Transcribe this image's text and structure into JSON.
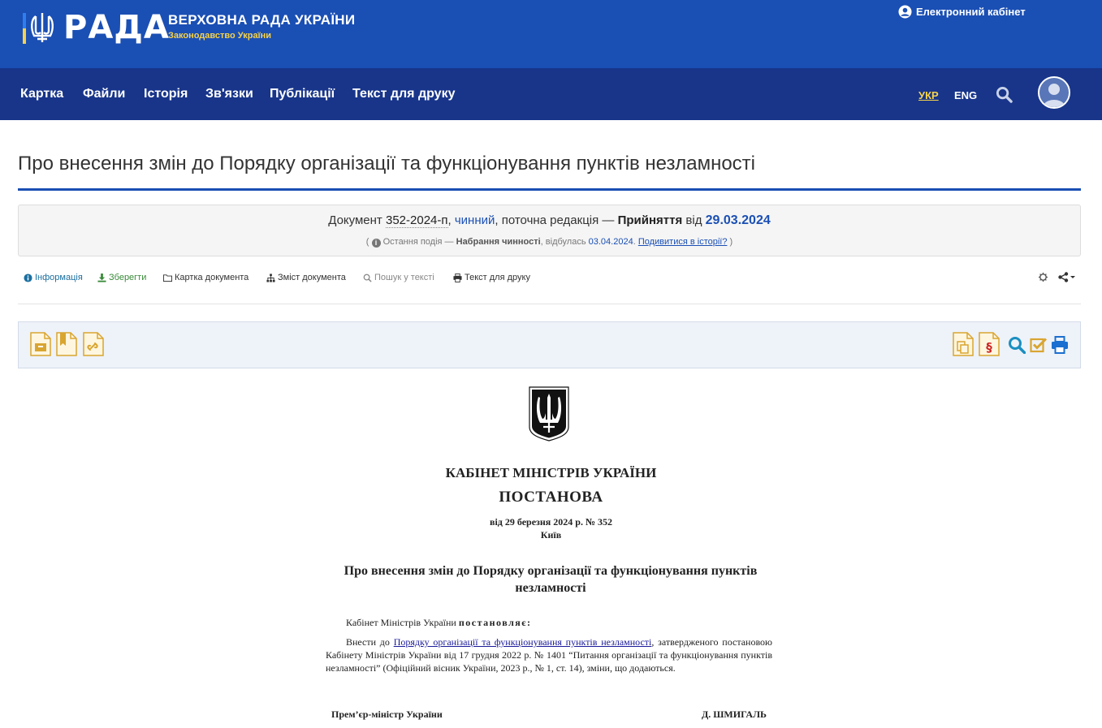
{
  "header": {
    "logo_text": "РАДА",
    "site_title": "ВЕРХОВНА РАДА УКРАЇНИ",
    "site_subtitle": "Законодавство України",
    "cabinet_link": "Електронний кабінет"
  },
  "nav": {
    "items": [
      "Картка",
      "Файли",
      "Історія",
      "Зв'язки",
      "Публікації",
      "Текст для друку"
    ],
    "lang_ukr": "УКР",
    "lang_eng": "ENG"
  },
  "page": {
    "title": "Про внесення змін до Порядку організації та функціонування пунктів незламності"
  },
  "status": {
    "doc_label": "Документ",
    "doc_number": "352-2024-п",
    "state": "чинний",
    "edition": "поточна редакція",
    "adoption": "Прийняття",
    "from": "від",
    "date": "29.03.2024",
    "last_event_label": "Остання подія",
    "last_event": "Набрання чинності",
    "occurred": "відбулась",
    "event_date": "03.04.2024",
    "history_link": "Подивитися в історії?"
  },
  "toolbar": {
    "info": "Інформація",
    "save": "Зберегти",
    "card": "Картка документа",
    "contents": "Зміст документа",
    "search": "Пошук у тексті",
    "print": "Текст для друку"
  },
  "document": {
    "org": "КАБІНЕТ МІНІСТРІВ УКРАЇНИ",
    "type": "ПОСТАНОВА",
    "date_line": "від 29 березня 2024 р. № 352",
    "city": "Київ",
    "title": "Про внесення змін до Порядку організації та функціонування пунктів незламності",
    "p1_text": "Кабінет Міністрів України",
    "p1_decides": "постановляє:",
    "p2_before": "Внести до",
    "p2_link": "Порядку організації та функціонування пунктів незламності",
    "p2_after": ", затвердженого постановою Кабінету Міністрів України від 17 грудня 2022 р. № 1401 “Питання організації та функціонування пунктів незламності” (Офіційний вісник України, 2023 р., № 1, ст. 14), зміни, що додаються.",
    "sign_position": "Прем’єр-міністр України",
    "sign_name": "Д. ШМИГАЛЬ"
  },
  "colors": {
    "header_blue": "#1a4fb4",
    "nav_blue": "#18358a",
    "accent_yellow": "#f5d24a",
    "doc_icon_gold": "#d9a531"
  },
  "icons": {
    "toolbar": [
      "info-icon",
      "download-icon",
      "folder-icon",
      "sitemap-icon",
      "search-icon",
      "print-icon"
    ],
    "panel_left": [
      "archive-doc-icon",
      "bookmark-doc-icon",
      "link-doc-icon"
    ],
    "panel_right": [
      "compare-doc-icon",
      "paragraph-doc-icon",
      "search-icon",
      "check-icon",
      "print-icon"
    ]
  }
}
